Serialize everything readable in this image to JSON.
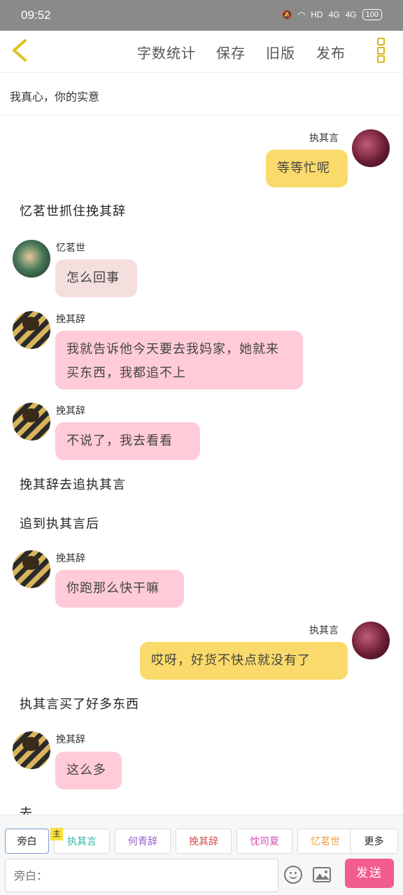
{
  "status_bar": {
    "time": "09:52",
    "network": "HD",
    "signal1": "4G",
    "signal2": "4G",
    "battery": "100"
  },
  "toolbar": {
    "word_count": "字数统计",
    "save": "保存",
    "old_version": "旧版",
    "publish": "发布"
  },
  "story": {
    "title": "我真心，你的实意"
  },
  "messages": [
    {
      "name": "执其言",
      "text": "等等忙呢"
    },
    {
      "narration": "忆茗世抓住挽其辞"
    },
    {
      "name": "忆茗世",
      "text": "怎么回事"
    },
    {
      "name": "挽其辞",
      "text": "我就告诉他今天要去我妈家，她就来买东西，我都追不上"
    },
    {
      "name": "挽其辞",
      "text": "不说了，我去看看"
    },
    {
      "narration": "挽其辞去追执其言"
    },
    {
      "narration": "追到执其言后"
    },
    {
      "name": "挽其辞",
      "text": "你跑那么快干嘛"
    },
    {
      "name": "执其言",
      "text": "哎呀，好货不快点就没有了"
    },
    {
      "narration": "执其言买了好多东西"
    },
    {
      "name": "挽其辞",
      "text": "这么多"
    },
    {
      "narration": "去"
    }
  ],
  "role_tabs": [
    {
      "label": "旁白",
      "color": "#333333"
    },
    {
      "label": "执其言",
      "color": "#2fb7a8",
      "tag": "主"
    },
    {
      "label": "何青辞",
      "color": "#9a5cc8"
    },
    {
      "label": "挽其辞",
      "color": "#d94a4a"
    },
    {
      "label": "忱司夏",
      "color": "#d24fb0"
    },
    {
      "label": "忆茗世",
      "color": "#f0a040"
    },
    {
      "label": "更多",
      "color": "#333333"
    }
  ],
  "composer": {
    "placeholder": "旁白：",
    "send": "发送"
  },
  "colors": {
    "accent": "#fada6a",
    "send": "#f25c90"
  }
}
